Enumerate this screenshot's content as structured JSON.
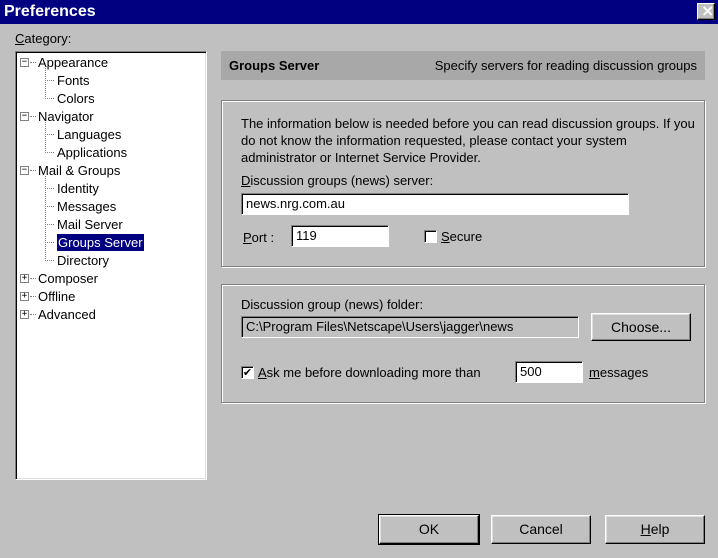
{
  "window": {
    "title": "Preferences",
    "close_glyph": "×"
  },
  "category": {
    "label_first": "C",
    "label_rest": "ategory:"
  },
  "tree": [
    {
      "label": "Appearance",
      "level": 0,
      "toggle": "−"
    },
    {
      "label": "Fonts",
      "level": 1
    },
    {
      "label": "Colors",
      "level": 1
    },
    {
      "label": "Navigator",
      "level": 0,
      "toggle": "−"
    },
    {
      "label": "Languages",
      "level": 1
    },
    {
      "label": "Applications",
      "level": 1
    },
    {
      "label": "Mail & Groups",
      "level": 0,
      "toggle": "−"
    },
    {
      "label": "Identity",
      "level": 1
    },
    {
      "label": "Messages",
      "level": 1
    },
    {
      "label": "Mail Server",
      "level": 1
    },
    {
      "label": "Groups Server",
      "level": 1,
      "selected": true
    },
    {
      "label": "Directory",
      "level": 1
    },
    {
      "label": "Composer",
      "level": 0,
      "toggle": "+"
    },
    {
      "label": "Offline",
      "level": 0,
      "toggle": "+"
    },
    {
      "label": "Advanced",
      "level": 0,
      "toggle": "+"
    }
  ],
  "header": {
    "title": "Groups Server",
    "description": "Specify servers for reading discussion groups"
  },
  "server_section": {
    "info": "The information below is needed before you can read discussion groups.  If you do not know the information requested, please contact your system administrator or Internet Service Provider.",
    "server_label_first": "D",
    "server_label_rest": "iscussion groups (news) server:",
    "server_value": "news.nrg.com.au",
    "port_label_first": "P",
    "port_label_rest": "ort :",
    "port_value": "119",
    "secure_label_first": "S",
    "secure_label_rest": "ecure",
    "secure_checked": false
  },
  "folder_section": {
    "folder_label_pre": "Discussion ",
    "folder_label_ul": "g",
    "folder_label_post": "roup (news) folder:",
    "folder_value": "C:\\Program Files\\Netscape\\Users\\jagger\\news",
    "choose_label": "Choose...",
    "ask_label_first": "A",
    "ask_label_rest": "sk me before downloading more than",
    "ask_checked": true,
    "check_glyph": "✔",
    "ask_value": "500",
    "messages_label_first": "m",
    "messages_label_rest": "essages"
  },
  "buttons": {
    "ok": "OK",
    "cancel": "Cancel",
    "help_first": "H",
    "help_rest": "elp"
  }
}
